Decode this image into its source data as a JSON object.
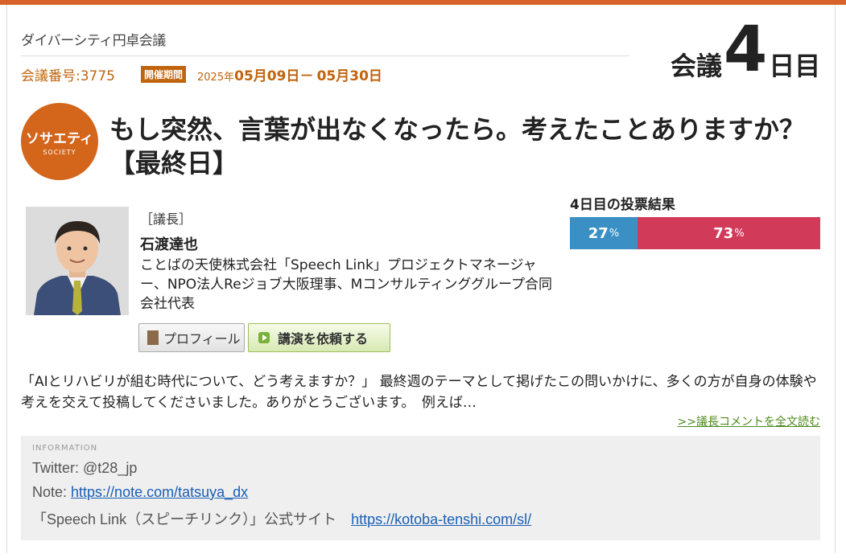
{
  "header": {
    "brand": "ダイバーシティ円卓会議",
    "meeting_number": "会議番号:3775",
    "period_badge": "開催期間",
    "period_year": "2025年",
    "period_start": "05月09日",
    "period_sep": "－",
    "period_end": "05月30日",
    "day_label_prefix": "会議",
    "day_number": "4",
    "day_label_suffix": "日目"
  },
  "category": {
    "label_jp": "ソサエティ",
    "label_en": "SOCIETY",
    "color": "#d4661c"
  },
  "title": "もし突然、言葉が出なくなったら。考えたことありますか？【最終日】",
  "chair": {
    "role": "［議長］",
    "name": "石渡達也",
    "description": "ことばの天使株式会社「Speech Link」プロジェクトマネージャー、NPO法人Reジョブ大阪理事、Mコンサルティンググループ合同会社代表"
  },
  "buttons": {
    "profile": "プロフィール",
    "lecture": "講演を依頼する"
  },
  "vote": {
    "title": "4日目の投票結果",
    "yes_percent": 27,
    "no_percent": 73,
    "unit": "%",
    "yes_color": "#3a8fc4",
    "no_color": "#d23a5a"
  },
  "comment": {
    "text": "「AIとリハビリが組む時代について、どう考えますか？」 最終週のテーマとして掲げたこの問いかけに、多くの方が自身の体験や考えを交えて投稿してくださいました。ありがとうございます。　例えば…",
    "read_more": ">>議長コメントを全文読む"
  },
  "info": {
    "label": "INFORMATION",
    "twitter": "Twitter: @t28_jp",
    "note_prefix": "Note: ",
    "note_link": "https://note.com/tatsuya_dx",
    "site_prefix": "「Speech Link（スピーチリンク）」公式サイト　",
    "site_link": "https://kotoba-tenshi.com/sl/"
  }
}
